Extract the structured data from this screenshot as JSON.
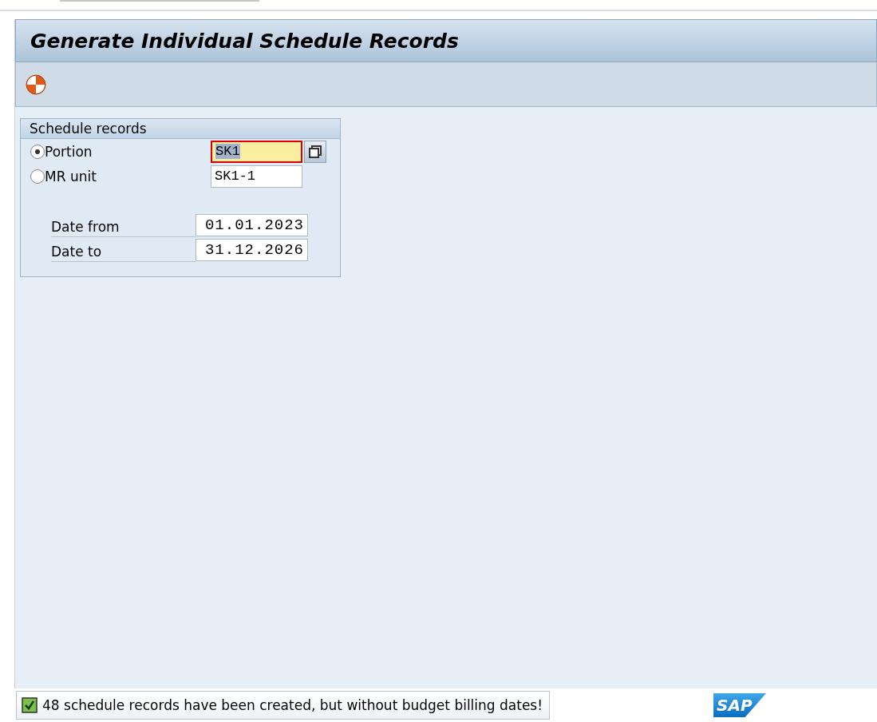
{
  "window": {
    "title": "Generate Individual Schedule Records"
  },
  "group": {
    "title": "Schedule records",
    "options": [
      {
        "label": "Portion",
        "selected": true,
        "value": "SK1",
        "focused": true,
        "has_help": true
      },
      {
        "label": "MR unit",
        "selected": false,
        "value": "SK1-1",
        "focused": false,
        "has_help": false
      }
    ],
    "dates": [
      {
        "label": "Date from",
        "value": "01.01.2023"
      },
      {
        "label": "Date to",
        "value": "31.12.2026"
      }
    ]
  },
  "status_bar": {
    "kind": "success",
    "message": "48 schedule records have been created, but without budget billing dates!",
    "logo": "SAP"
  }
}
